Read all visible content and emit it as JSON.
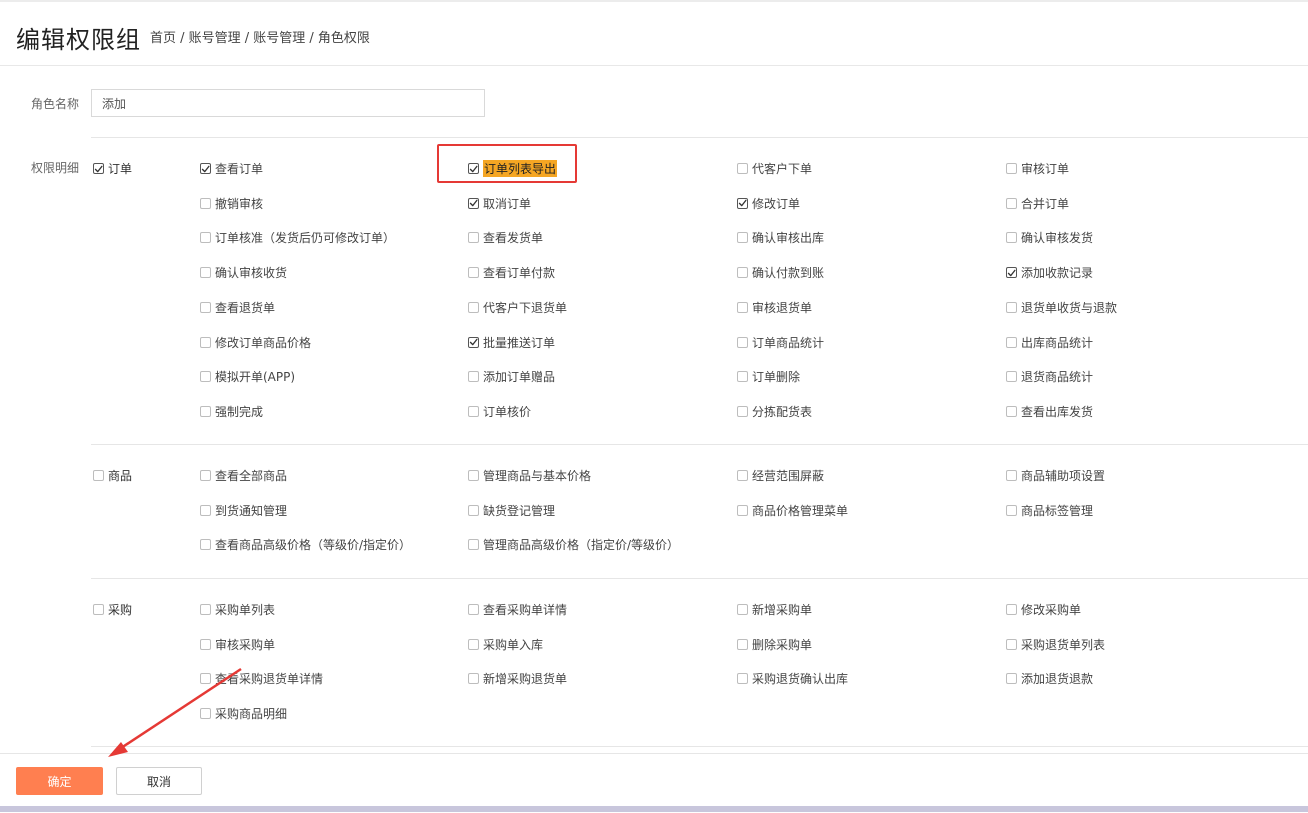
{
  "header": {
    "title": "编辑权限组",
    "breadcrumb": "首页 / 账号管理 / 账号管理 / 角色权限"
  },
  "form": {
    "role_name_label": "角色名称",
    "role_name_value": "添加",
    "permissions_label": "权限明细"
  },
  "groups": {
    "order": {
      "label": "订单",
      "checked": true,
      "items": [
        {
          "label": "查看订单",
          "checked": true
        },
        {
          "label": "订单列表导出",
          "checked": true,
          "highlighted": true
        },
        {
          "label": "代客户下单",
          "checked": false
        },
        {
          "label": "审核订单",
          "checked": false
        },
        {
          "label": "撤销审核",
          "checked": false
        },
        {
          "label": "取消订单",
          "checked": true
        },
        {
          "label": "修改订单",
          "checked": true
        },
        {
          "label": "合并订单",
          "checked": false
        },
        {
          "label": "订单核准（发货后仍可修改订单）",
          "checked": false
        },
        {
          "label": "查看发货单",
          "checked": false
        },
        {
          "label": "确认审核出库",
          "checked": false
        },
        {
          "label": "确认审核发货",
          "checked": false
        },
        {
          "label": "确认审核收货",
          "checked": false
        },
        {
          "label": "查看订单付款",
          "checked": false
        },
        {
          "label": "确认付款到账",
          "checked": false
        },
        {
          "label": "添加收款记录",
          "checked": true
        },
        {
          "label": "查看退货单",
          "checked": false
        },
        {
          "label": "代客户下退货单",
          "checked": false
        },
        {
          "label": "审核退货单",
          "checked": false
        },
        {
          "label": "退货单收货与退款",
          "checked": false
        },
        {
          "label": "修改订单商品价格",
          "checked": false
        },
        {
          "label": "批量推送订单",
          "checked": true
        },
        {
          "label": "订单商品统计",
          "checked": false
        },
        {
          "label": "出库商品统计",
          "checked": false
        },
        {
          "label": "模拟开单(APP)",
          "checked": false
        },
        {
          "label": "添加订单赠品",
          "checked": false
        },
        {
          "label": "订单删除",
          "checked": false
        },
        {
          "label": "退货商品统计",
          "checked": false
        },
        {
          "label": "强制完成",
          "checked": false
        },
        {
          "label": "订单核价",
          "checked": false
        },
        {
          "label": "分拣配货表",
          "checked": false
        },
        {
          "label": "查看出库发货",
          "checked": false
        }
      ]
    },
    "product": {
      "label": "商品",
      "checked": false,
      "items": [
        {
          "label": "查看全部商品",
          "checked": false
        },
        {
          "label": "管理商品与基本价格",
          "checked": false
        },
        {
          "label": "经营范围屏蔽",
          "checked": false
        },
        {
          "label": "商品辅助项设置",
          "checked": false
        },
        {
          "label": "到货通知管理",
          "checked": false
        },
        {
          "label": "缺货登记管理",
          "checked": false
        },
        {
          "label": "商品价格管理菜单",
          "checked": false
        },
        {
          "label": "商品标签管理",
          "checked": false
        },
        {
          "label": "查看商品高级价格（等级价/指定价）",
          "checked": false
        },
        {
          "label": "管理商品高级价格（指定价/等级价）",
          "checked": false
        }
      ]
    },
    "purchase": {
      "label": "采购",
      "checked": false,
      "items": [
        {
          "label": "采购单列表",
          "checked": false
        },
        {
          "label": "查看采购单详情",
          "checked": false
        },
        {
          "label": "新增采购单",
          "checked": false
        },
        {
          "label": "修改采购单",
          "checked": false
        },
        {
          "label": "审核采购单",
          "checked": false
        },
        {
          "label": "采购单入库",
          "checked": false
        },
        {
          "label": "删除采购单",
          "checked": false
        },
        {
          "label": "采购退货单列表",
          "checked": false
        },
        {
          "label": "查看采购退货单详情",
          "checked": false
        },
        {
          "label": "新增采购退货单",
          "checked": false
        },
        {
          "label": "采购退货确认出库",
          "checked": false
        },
        {
          "label": "添加退货退款",
          "checked": false
        },
        {
          "label": "采购商品明细",
          "checked": false
        }
      ]
    }
  },
  "footer": {
    "ok_label": "确定",
    "cancel_label": "取消"
  },
  "colors": {
    "primary_button": "#ff7f50",
    "highlight_box": "#e53935",
    "highlight_text_bg": "#f5a623",
    "arrow": "#e53935"
  }
}
